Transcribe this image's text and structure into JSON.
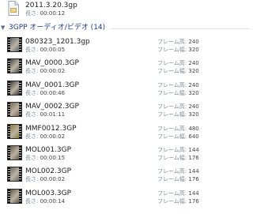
{
  "top_item": {
    "name": "2011.3.20.3gp",
    "duration_label": "長さ:",
    "duration": "00:00:12"
  },
  "group": {
    "title": "3GPP オーディオ/ビデオ (14)"
  },
  "labels": {
    "duration": "長さ:",
    "frame_height": "フレーム高:",
    "frame_width": "フレーム幅:"
  },
  "files": [
    {
      "name": "080323_1201.3gp",
      "duration": "00:00:05",
      "frame_height": "240",
      "frame_width": "320",
      "thumb": "#5b6770"
    },
    {
      "name": "MAV_0000.3GP",
      "duration": "00:00:02",
      "frame_height": "240",
      "frame_width": "320",
      "thumb": "#4a4a4a"
    },
    {
      "name": "MAV_0001.3GP",
      "duration": "00:00:46",
      "frame_height": "240",
      "frame_width": "320",
      "thumb": "#3c3a36"
    },
    {
      "name": "MAV_0002.3GP",
      "duration": "00:01:11",
      "frame_height": "240",
      "frame_width": "320",
      "thumb": "#7a6a52"
    },
    {
      "name": "MMF0012.3GP",
      "duration": "00:00:02",
      "frame_height": "480",
      "frame_width": "640",
      "thumb": "#8a7a3a"
    },
    {
      "name": "MOL001.3GP",
      "duration": "00:00:15",
      "frame_height": "144",
      "frame_width": "176",
      "thumb": "#6b5a48"
    },
    {
      "name": "MOL002.3GP",
      "duration": "00:00:02",
      "frame_height": "144",
      "frame_width": "176",
      "thumb": "#6f6a60"
    },
    {
      "name": "MOL003.3GP",
      "duration": "00:00:14",
      "frame_height": "144",
      "frame_width": "176",
      "thumb": "#5e564c"
    }
  ]
}
